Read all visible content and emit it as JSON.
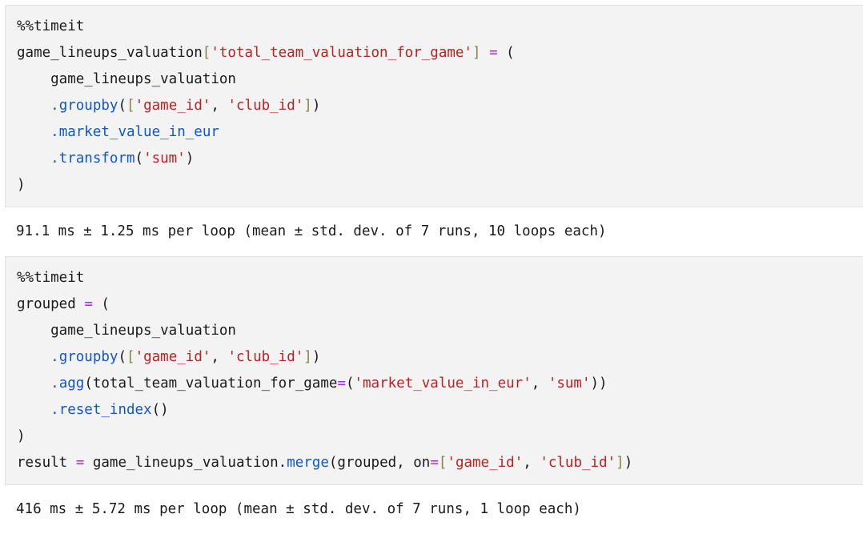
{
  "notebook": {
    "cells": [
      {
        "type": "code",
        "lines": [
          [
            {
              "t": "%%timeit",
              "c": "magic"
            }
          ],
          [
            {
              "t": "game_lineups_valuation",
              "c": "plain"
            },
            {
              "t": "[",
              "c": "bracket"
            },
            {
              "t": "'total_team_valuation_for_game'",
              "c": "str"
            },
            {
              "t": "]",
              "c": "bracket"
            },
            {
              "t": " ",
              "c": "plain"
            },
            {
              "t": "=",
              "c": "op"
            },
            {
              "t": " (",
              "c": "paren"
            }
          ],
          [
            {
              "t": "    game_lineups_valuation",
              "c": "plain"
            }
          ],
          [
            {
              "t": "    ",
              "c": "plain"
            },
            {
              "t": ".",
              "c": "dot"
            },
            {
              "t": "groupby",
              "c": "method"
            },
            {
              "t": "(",
              "c": "paren"
            },
            {
              "t": "[",
              "c": "bracket"
            },
            {
              "t": "'game_id'",
              "c": "str"
            },
            {
              "t": ", ",
              "c": "plain"
            },
            {
              "t": "'club_id'",
              "c": "str"
            },
            {
              "t": "]",
              "c": "bracket"
            },
            {
              "t": ")",
              "c": "paren"
            }
          ],
          [
            {
              "t": "    ",
              "c": "plain"
            },
            {
              "t": ".",
              "c": "dot"
            },
            {
              "t": "market_value_in_eur",
              "c": "method"
            }
          ],
          [
            {
              "t": "    ",
              "c": "plain"
            },
            {
              "t": ".",
              "c": "dot"
            },
            {
              "t": "transform",
              "c": "method"
            },
            {
              "t": "(",
              "c": "paren"
            },
            {
              "t": "'sum'",
              "c": "str"
            },
            {
              "t": ")",
              "c": "paren"
            }
          ],
          [
            {
              "t": ")",
              "c": "paren"
            }
          ]
        ]
      },
      {
        "type": "output",
        "text": "91.1 ms ± 1.25 ms per loop (mean ± std. dev. of 7 runs, 10 loops each)"
      },
      {
        "type": "code",
        "lines": [
          [
            {
              "t": "%%timeit",
              "c": "magic"
            }
          ],
          [
            {
              "t": "grouped",
              "c": "plain"
            },
            {
              "t": " ",
              "c": "plain"
            },
            {
              "t": "=",
              "c": "op"
            },
            {
              "t": " (",
              "c": "paren"
            }
          ],
          [
            {
              "t": "    game_lineups_valuation",
              "c": "plain"
            }
          ],
          [
            {
              "t": "    ",
              "c": "plain"
            },
            {
              "t": ".",
              "c": "dot"
            },
            {
              "t": "groupby",
              "c": "method"
            },
            {
              "t": "(",
              "c": "paren"
            },
            {
              "t": "[",
              "c": "bracket"
            },
            {
              "t": "'game_id'",
              "c": "str"
            },
            {
              "t": ", ",
              "c": "plain"
            },
            {
              "t": "'club_id'",
              "c": "str"
            },
            {
              "t": "]",
              "c": "bracket"
            },
            {
              "t": ")",
              "c": "paren"
            }
          ],
          [
            {
              "t": "    ",
              "c": "plain"
            },
            {
              "t": ".",
              "c": "dot"
            },
            {
              "t": "agg",
              "c": "method"
            },
            {
              "t": "(total_team_valuation_for_game",
              "c": "plain"
            },
            {
              "t": "=",
              "c": "op"
            },
            {
              "t": "(",
              "c": "paren"
            },
            {
              "t": "'market_value_in_eur'",
              "c": "str"
            },
            {
              "t": ", ",
              "c": "plain"
            },
            {
              "t": "'sum'",
              "c": "str"
            },
            {
              "t": "))",
              "c": "paren"
            }
          ],
          [
            {
              "t": "    ",
              "c": "plain"
            },
            {
              "t": ".",
              "c": "dot"
            },
            {
              "t": "reset_index",
              "c": "method"
            },
            {
              "t": "()",
              "c": "paren"
            }
          ],
          [
            {
              "t": ")",
              "c": "paren"
            }
          ],
          [
            {
              "t": "result",
              "c": "plain"
            },
            {
              "t": " ",
              "c": "plain"
            },
            {
              "t": "=",
              "c": "op"
            },
            {
              "t": " game_lineups_valuation.",
              "c": "plain"
            },
            {
              "t": "merge",
              "c": "method"
            },
            {
              "t": "(grouped, on",
              "c": "plain"
            },
            {
              "t": "=",
              "c": "op"
            },
            {
              "t": "[",
              "c": "bracket"
            },
            {
              "t": "'game_id'",
              "c": "str"
            },
            {
              "t": ", ",
              "c": "plain"
            },
            {
              "t": "'club_id'",
              "c": "str"
            },
            {
              "t": "]",
              "c": "bracket"
            },
            {
              "t": ")",
              "c": "paren"
            }
          ]
        ]
      },
      {
        "type": "output",
        "text": "416 ms ± 5.72 ms per loop (mean ± std. dev. of 7 runs, 1 loop each)"
      }
    ]
  },
  "colors": {
    "cell_background": "#f3f3f3",
    "cell_border": "#e0e0e0",
    "page_background": "#ffffff",
    "text": "#1a1a1a",
    "method": "#1155cc",
    "string": "#bb2222",
    "bracket": "#85854a",
    "operator": "#aa22ff"
  }
}
